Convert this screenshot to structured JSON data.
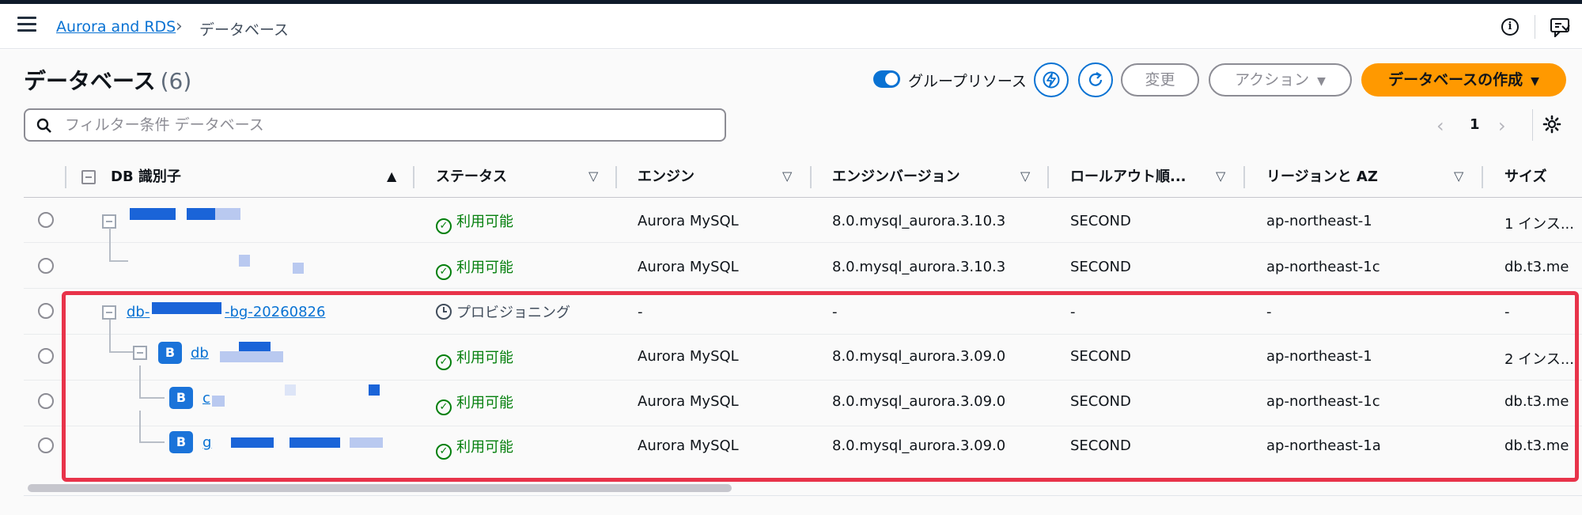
{
  "breadcrumb": {
    "parent": "Aurora and RDS",
    "current": "データベース"
  },
  "header": {
    "title": "データベース",
    "count": "(6)",
    "group_toggle_label": "グループリソース",
    "modify_label": "変更",
    "actions_label": "アクション",
    "create_label": "データベースの作成"
  },
  "search": {
    "placeholder": "フィルター条件 データベース",
    "value": ""
  },
  "pagination": {
    "current_page": "1"
  },
  "columns": [
    "DB 識別子",
    "ステータス",
    "エンジン",
    "エンジンバージョン",
    "ロールアウト順...",
    "リージョンと AZ",
    "サイズ"
  ],
  "rows": [
    {
      "id": "",
      "status": "利用可能",
      "engine": "Aurora MySQL",
      "version": "8.0.mysql_aurora.3.10.3",
      "rollout": "SECOND",
      "region": "ap-northeast-1",
      "size": "1 インス..."
    },
    {
      "id": "",
      "status": "利用可能",
      "engine": "Aurora MySQL",
      "version": "8.0.mysql_aurora.3.10.3",
      "rollout": "SECOND",
      "region": "ap-northeast-1c",
      "size": "db.t3.me"
    },
    {
      "id_prefix": "db-",
      "id_suffix": "-bg-20260826",
      "status": "プロビジョニング",
      "engine": "-",
      "version": "-",
      "rollout": "-",
      "region": "-",
      "size": "-"
    },
    {
      "id": "db",
      "badge": "B",
      "status": "利用可能",
      "engine": "Aurora MySQL",
      "version": "8.0.mysql_aurora.3.09.0",
      "rollout": "SECOND",
      "region": "ap-northeast-1",
      "size": "2 インス..."
    },
    {
      "id": "c",
      "badge": "B",
      "status": "利用可能",
      "engine": "Aurora MySQL",
      "version": "8.0.mysql_aurora.3.09.0",
      "rollout": "SECOND",
      "region": "ap-northeast-1c",
      "size": "db.t3.me"
    },
    {
      "id": "g",
      "badge": "B",
      "status": "利用可能",
      "engine": "Aurora MySQL",
      "version": "8.0.mysql_aurora.3.09.0",
      "rollout": "SECOND",
      "region": "ap-northeast-1a",
      "size": "db.t3.me"
    }
  ],
  "colors": {
    "link": "#0972d3",
    "primary": "#ff9900",
    "available": "#037f0c",
    "highlight": "#e8334a",
    "badge": "#1a73d9"
  },
  "icons": [
    "menu-icon",
    "chevron-right-icon",
    "info-icon",
    "feedback-icon",
    "toggle",
    "lightning-icon",
    "refresh-icon",
    "caret-down-icon",
    "search-icon",
    "chevron-left-icon",
    "gear-icon",
    "sort-up-icon",
    "sort-down-outline-icon",
    "check-circle-icon",
    "clock-icon"
  ]
}
